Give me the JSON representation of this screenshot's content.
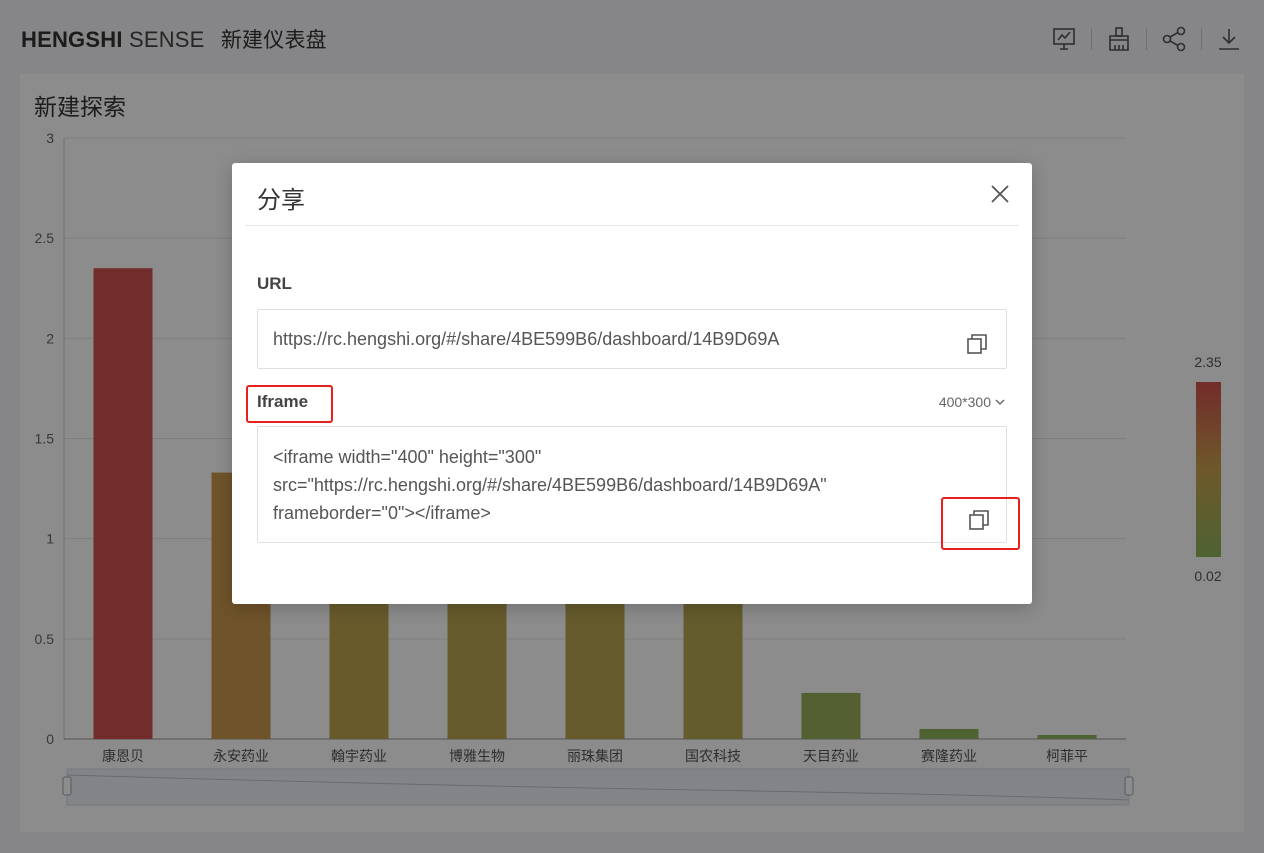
{
  "header": {
    "brand_bold": "HENGSHI",
    "brand_light": "SENSE",
    "dashboard_title": "新建仪表盘",
    "toolbar_icons": [
      "present-icon",
      "brush-icon",
      "share-icon",
      "download-icon"
    ]
  },
  "card": {
    "title": "新建探索"
  },
  "chart_data": {
    "type": "bar",
    "categories": [
      "康恩贝",
      "永安药业",
      "翰宇药业",
      "博雅生物",
      "丽珠集团",
      "国农科技",
      "天目药业",
      "赛隆药业",
      "柯菲平"
    ],
    "values": [
      2.35,
      1.33,
      1.0,
      0.9,
      0.85,
      0.8,
      0.23,
      0.05,
      0.02
    ],
    "ylim": [
      0,
      3
    ],
    "yticks": [
      "0",
      "0.5",
      "1",
      "1.5",
      "2",
      "2.5",
      "3"
    ],
    "grid": true,
    "color_scale": {
      "max_label": "2.35",
      "min_label": "0.02",
      "high": "#d0504f",
      "mid": "#c9a24e",
      "low": "#8fb35c"
    }
  },
  "modal": {
    "title": "分享",
    "url_label": "URL",
    "url_value": "https://rc.hengshi.org/#/share/4BE599B6/dashboard/14B9D69A",
    "iframe_label": "Iframe",
    "iframe_size": "400*300",
    "iframe_code": "<iframe width=\"400\" height=\"300\"\nsrc=\"https://rc.hengshi.org/#/share/4BE599B6/dashboard/14B9D69A\"\nframeborder=\"0\"></iframe>"
  },
  "colors": {
    "highlight": "#e8201b"
  }
}
